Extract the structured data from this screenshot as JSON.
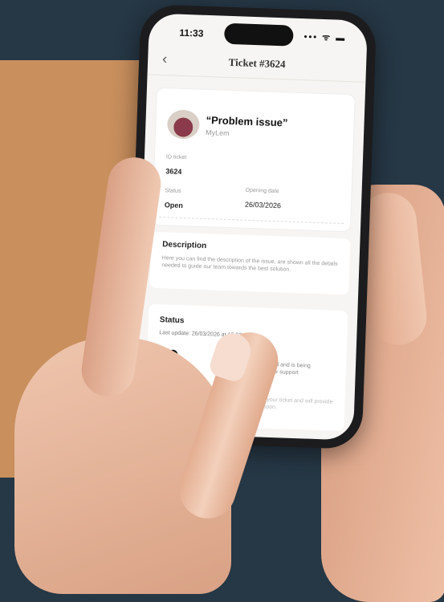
{
  "statusbar": {
    "time": "11:33",
    "signal": "••• ᯤ ▬"
  },
  "navbar": {
    "back_icon": "‹",
    "title": "Ticket #3624"
  },
  "ticket": {
    "title": "“Problem issue”",
    "subtitle": "MyLem",
    "id_label": "ID ticket",
    "id_value": "3624",
    "status_label": "Status",
    "status_value": "Open",
    "opening_label": "Opening date",
    "opening_value": "26/03/2026"
  },
  "description": {
    "title": "Description",
    "text": "Here you can find the description of the issue, are shown all the details needed to guide our team towards the best solution."
  },
  "status_section": {
    "title": "Status",
    "last_update": "Last update: 26/03/2026 at 15:03",
    "step1": "has been created and is being processed by our support",
    "step2": "is evaluating your ticket and will provide a response soon."
  }
}
